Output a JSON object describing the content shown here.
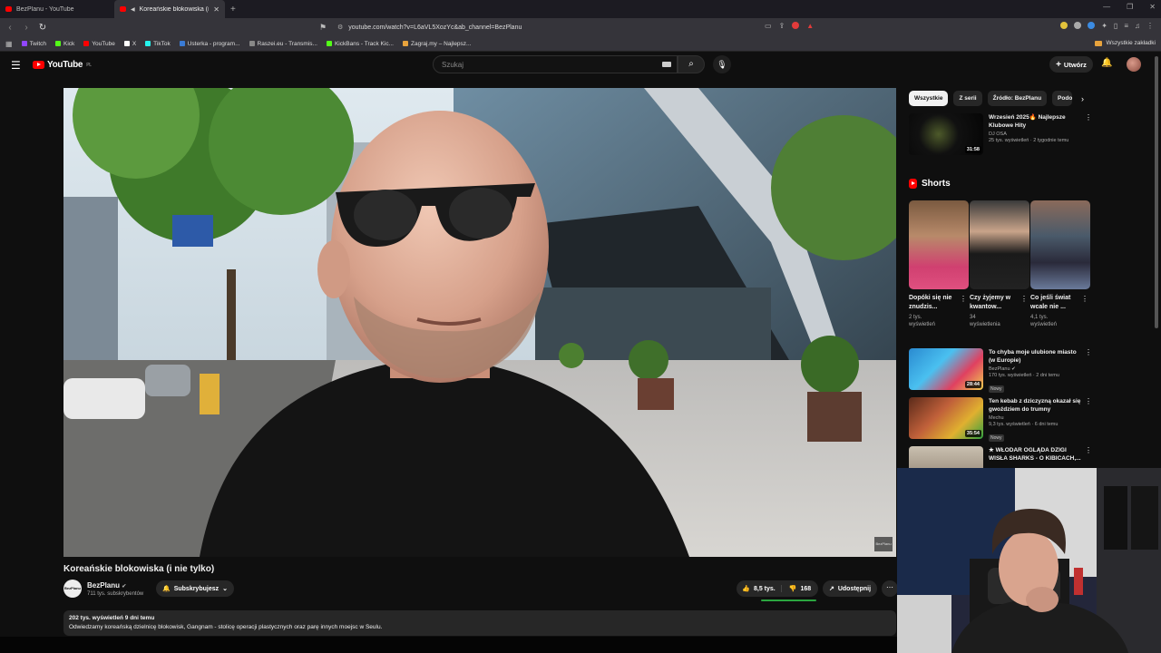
{
  "browser": {
    "tabs": [
      {
        "title": "BezPlanu - YouTube"
      },
      {
        "title": "Koreańskie blokowiska (i nie t"
      }
    ],
    "url": "youtube.com/watch?v=L6aVL5XozYc&ab_channel=BezPlanu",
    "bookmarks": [
      {
        "label": "Twitch",
        "color": "#9146ff"
      },
      {
        "label": "Kick",
        "color": "#53fc18"
      },
      {
        "label": "YouTube",
        "color": "#ff0000"
      },
      {
        "label": "X",
        "color": "#ffffff"
      },
      {
        "label": "TikTok",
        "color": "#25f4ee"
      },
      {
        "label": "Usterka - program...",
        "color": "#3a7bd5"
      },
      {
        "label": "Raszei.eu - Transmis...",
        "color": "#888888"
      },
      {
        "label": "KickBans - Track Kic...",
        "color": "#53fc18"
      },
      {
        "label": "Zagraj.my – Najlepsz...",
        "color": "#e8a33d"
      }
    ],
    "all_bookmarks": "Wszystkie zakładki"
  },
  "youtube": {
    "logo_text": "YouTube",
    "logo_region": "PL",
    "search_placeholder": "Szukaj",
    "create_label": "Utwórz"
  },
  "video": {
    "title": "Koreańskie blokowiska (i nie tylko)",
    "watermark": "BezPlanu",
    "channel": {
      "name": "BezPlanu",
      "avatar_text": "BezPlanu",
      "subscribers": "711 tys. subskrybentów"
    },
    "subscribe_label": "Subskrybujesz",
    "likes": "8,5 tys.",
    "dislikes": "168",
    "share_label": "Udostępnij",
    "views_meta": "202 tys. wyświetleń  9 dni temu",
    "description": "Odwiedzamy koreańską dzielnicę blokowisk, Gangnam - stolicę operacji plastycznych oraz parę innych moejsc w Seulu."
  },
  "sidebar": {
    "chips": [
      "Wszystkie",
      "Z serii",
      "Źródło: BezPlanu",
      "Podo"
    ],
    "top_video": {
      "title": "Wrzesień 2025🔥 Najlepsze Klubowe Hity",
      "channel": "DJ OSA",
      "meta": "25 tys. wyświetleń · 2 tygodnie temu",
      "duration": "31:58"
    },
    "shorts_title": "Shorts",
    "shorts": [
      {
        "title": "Dopóki się nie znudzis...",
        "views": "2 tys. wyświetleń"
      },
      {
        "title": "Czy żyjemy w kwantow...",
        "views": "34 wyświetlenia"
      },
      {
        "title": "Co jeśli świat wcale nie ...",
        "views": "4,1 tys. wyświetleń"
      }
    ],
    "videos": [
      {
        "title": "To chyba moje ulubione miasto (w Europie)",
        "channel": "BezPlanu",
        "meta": "170 tys. wyświetleń · 2 dni temu",
        "badge": "Nowy",
        "duration": "28:44"
      },
      {
        "title": "Ten kebab z dziczyzną okazał się gwoździem do trumny",
        "channel": "Mechu",
        "meta": "9,3 tys. wyświetleń · 6 dni temu",
        "badge": "Nowy",
        "duration": "35:54"
      },
      {
        "title": "★ WŁODAR OGLĄDA DZIGI WISŁA SHARKS - O KIBICACH,...",
        "channel": "",
        "meta": "",
        "badge": "",
        "duration": ""
      }
    ]
  }
}
